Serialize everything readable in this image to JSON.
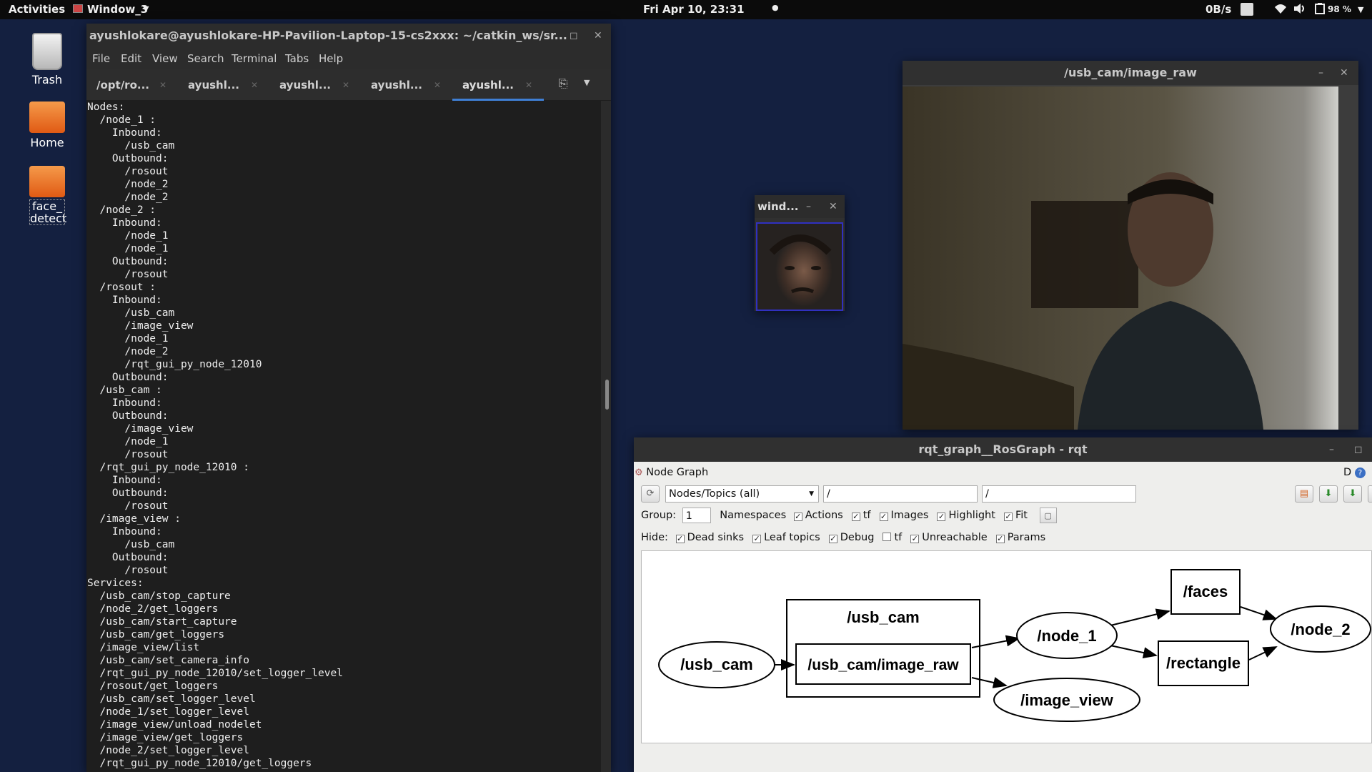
{
  "topbar": {
    "activities": "Activities",
    "app_menu": "Window_3",
    "clock": "Fri Apr 10, 23:31",
    "net_speed": "0B/s",
    "battery": "98 %"
  },
  "desktop": {
    "icons": [
      {
        "label": "Trash"
      },
      {
        "label": "Home"
      },
      {
        "label": "face_\ndetect"
      }
    ]
  },
  "terminal": {
    "title": "ayushlokare@ayushlokare-HP-Pavilion-Laptop-15-cs2xxx: ~/catkin_ws/sr...",
    "menu": [
      "File",
      "Edit",
      "View",
      "Search",
      "Terminal",
      "Tabs",
      "Help"
    ],
    "tabs": [
      "/opt/ro...",
      "ayushl...",
      "ayushl...",
      "ayushl...",
      "ayushl..."
    ],
    "output": "Nodes:\n  /node_1 :\n    Inbound:\n      /usb_cam\n    Outbound:\n      /rosout\n      /node_2\n      /node_2\n  /node_2 :\n    Inbound:\n      /node_1\n      /node_1\n    Outbound:\n      /rosout\n  /rosout :\n    Inbound:\n      /usb_cam\n      /image_view\n      /node_1\n      /node_2\n      /rqt_gui_py_node_12010\n    Outbound:\n  /usb_cam :\n    Inbound:\n    Outbound:\n      /image_view\n      /node_1\n      /rosout\n  /rqt_gui_py_node_12010 :\n    Inbound:\n    Outbound:\n      /rosout\n  /image_view :\n    Inbound:\n      /usb_cam\n    Outbound:\n      /rosout\nServices:\n  /usb_cam/stop_capture\n  /node_2/get_loggers\n  /usb_cam/start_capture\n  /usb_cam/get_loggers\n  /image_view/list\n  /usb_cam/set_camera_info\n  /rqt_gui_py_node_12010/set_logger_level\n  /rosout/get_loggers\n  /usb_cam/set_logger_level\n  /node_1/set_logger_level\n  /image_view/unload_nodelet\n  /image_view/get_loggers\n  /node_2/set_logger_level\n  /rqt_gui_py_node_12010/get_loggers"
  },
  "camera_window": {
    "title": "/usb_cam/image_raw"
  },
  "face_window": {
    "title": "wind..."
  },
  "rqt": {
    "title": "rqt_graph__RosGraph - rqt",
    "plugin_label": "Node Graph",
    "plugin_right": "D",
    "filter_mode": "Nodes/Topics (all)",
    "ns_filter": "/",
    "topic_filter": "/",
    "group_label": "Group:",
    "group_value": "1",
    "namespaces_label": "Namespaces",
    "row1_checks": [
      {
        "label": "Actions",
        "checked": true
      },
      {
        "label": "tf",
        "checked": true
      },
      {
        "label": "Images",
        "checked": true
      },
      {
        "label": "Highlight",
        "checked": true
      },
      {
        "label": "Fit",
        "checked": true
      }
    ],
    "hide_label": "Hide:",
    "row2_checks": [
      {
        "label": "Dead sinks",
        "checked": true
      },
      {
        "label": "Leaf topics",
        "checked": true
      },
      {
        "label": "Debug",
        "checked": true
      },
      {
        "label": "tf",
        "checked": false
      },
      {
        "label": "Unreachable",
        "checked": true
      },
      {
        "label": "Params",
        "checked": true
      }
    ],
    "graph": {
      "group_label": "/usb_cam",
      "nodes": [
        "/usb_cam",
        "/node_1",
        "/image_view",
        "/node_2"
      ],
      "topics": [
        "/usb_cam/image_raw",
        "/faces",
        "/rectangle"
      ],
      "edges": [
        [
          "/usb_cam",
          "/usb_cam/image_raw"
        ],
        [
          "/usb_cam/image_raw",
          "/node_1"
        ],
        [
          "/usb_cam/image_raw",
          "/image_view"
        ],
        [
          "/node_1",
          "/faces"
        ],
        [
          "/node_1",
          "/rectangle"
        ],
        [
          "/faces",
          "/node_2"
        ],
        [
          "/rectangle",
          "/node_2"
        ]
      ]
    }
  }
}
